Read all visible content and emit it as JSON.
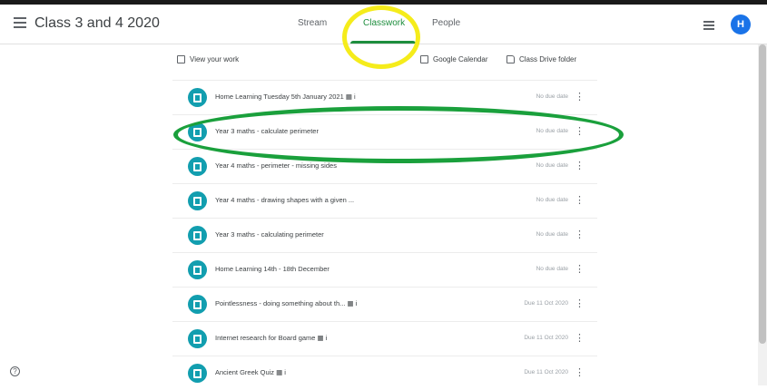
{
  "header": {
    "class_title": "Class 3 and 4 2020",
    "tabs": [
      {
        "label": "Stream"
      },
      {
        "label": "Classwork"
      },
      {
        "label": "People"
      }
    ],
    "avatar_initial": "H"
  },
  "toolbar": {
    "view_work": "View your work",
    "google_calendar": "Google Calendar",
    "drive_folder": "Class Drive folder"
  },
  "assignments": [
    {
      "title": "Home Learning Tuesday 5th January 2021 ▦ i",
      "date": "No due date"
    },
    {
      "title": "Year 3 maths - calculate perimeter",
      "date": "No due date"
    },
    {
      "title": "Year 4 maths - perimeter - missing sides",
      "date": "No due date"
    },
    {
      "title": "Year 4 maths - drawing shapes with a given ...",
      "date": "No due date"
    },
    {
      "title": "Year 3 maths - calculating perimeter",
      "date": "No due date"
    },
    {
      "title": "Home Learning 14th - 18th December",
      "date": "No due date"
    },
    {
      "title": "Pointlessness - doing something about th... ▦ i",
      "date": "Due 11 Oct 2020"
    },
    {
      "title": "Internet research for Board game ▦ i",
      "date": "Due 11 Oct 2020"
    },
    {
      "title": "Ancient Greek Quiz ▦ i",
      "date": "Due 11 Oct 2020"
    }
  ],
  "colors": {
    "accent": "#1e8e3e",
    "assignment_icon": "#129eaf",
    "annotation_yellow": "#f5ec1b",
    "annotation_green": "#1aa03c"
  }
}
